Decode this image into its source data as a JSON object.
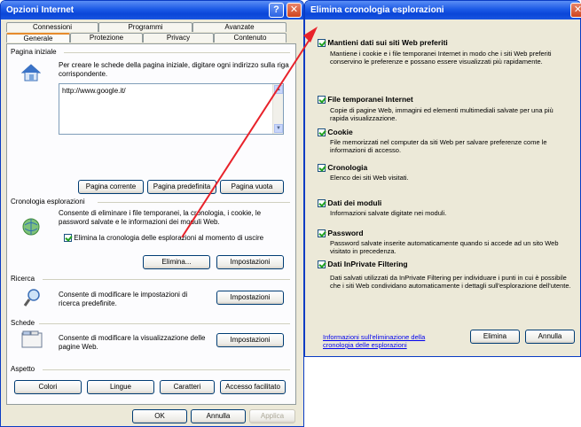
{
  "left_dialog": {
    "title": "Opzioni Internet",
    "help_btn": "?",
    "close_btn": "✕",
    "tabs_top": [
      "Connessioni",
      "Programmi",
      "Avanzate"
    ],
    "tabs_bottom": [
      "Generale",
      "Protezione",
      "Privacy",
      "Contenuto"
    ],
    "home": {
      "label": "Pagina iniziale",
      "desc": "Per creare le schede della pagina iniziale, digitare ogni indirizzo sulla riga corrispondente.",
      "url": "http://www.google.it/",
      "btn_current": "Pagina corrente",
      "btn_default": "Pagina predefinita",
      "btn_blank": "Pagina vuota"
    },
    "history": {
      "label": "Cronologia esplorazioni",
      "desc": "Consente di eliminare i file temporanei, la cronologia, i cookie, le password salvate e le informazioni dei moduli Web.",
      "checkbox": "Elimina la cronologia delle esplorazioni al momento di uscire",
      "btn_delete": "Elimina...",
      "btn_settings": "Impostazioni"
    },
    "search": {
      "label": "Ricerca",
      "desc": "Consente di modificare le impostazioni di ricerca predefinite.",
      "btn_settings": "Impostazioni"
    },
    "tabs_section": {
      "label": "Schede",
      "desc": "Consente di modificare la visualizzazione delle pagine Web.",
      "btn_settings": "Impostazioni"
    },
    "appearance": {
      "label": "Aspetto",
      "btn_colors": "Colori",
      "btn_languages": "Lingue",
      "btn_fonts": "Caratteri",
      "btn_access": "Accesso facilitato"
    },
    "footer": {
      "ok": "OK",
      "cancel": "Annulla",
      "apply": "Applica"
    }
  },
  "right_dialog": {
    "title": "Elimina cronologia esplorazioni",
    "close_btn": "✕",
    "options": [
      {
        "title": "Mantieni dati sui siti Web preferiti",
        "desc": "Mantiene i cookie e i file temporanei Internet in modo che i siti Web preferiti conservino le preferenze e possano essere visualizzati più rapidamente."
      },
      {
        "title": "File temporanei Internet",
        "desc": "Copie di pagine Web, immagini ed elementi multimediali salvate per una più rapida visualizzazione."
      },
      {
        "title": "Cookie",
        "desc": "File memorizzati nel computer da siti Web per salvare preferenze come le informazioni di accesso."
      },
      {
        "title": "Cronologia",
        "desc": "Elenco dei siti Web visitati."
      },
      {
        "title": "Dati dei moduli",
        "desc": "Informazioni salvate digitate nei moduli."
      },
      {
        "title": "Password",
        "desc": "Password salvate inserite automaticamente quando si accede ad un sito Web visitato in precedenza."
      },
      {
        "title": "Dati InPrivate Filtering",
        "desc": "Dati salvati utilizzati da InPrivate Filtering per individuare i punti in cui è possibile che i siti Web condividano automaticamente i dettagli sull'esplorazione dell'utente."
      }
    ],
    "link": "Informazioni sull'eliminazione della cronologia delle esplorazioni",
    "btn_delete": "Elimina",
    "btn_cancel": "Annulla"
  },
  "colors": {
    "arrow": "#e8222a",
    "title_blue": "#0a46d8",
    "link": "#0000ee"
  }
}
